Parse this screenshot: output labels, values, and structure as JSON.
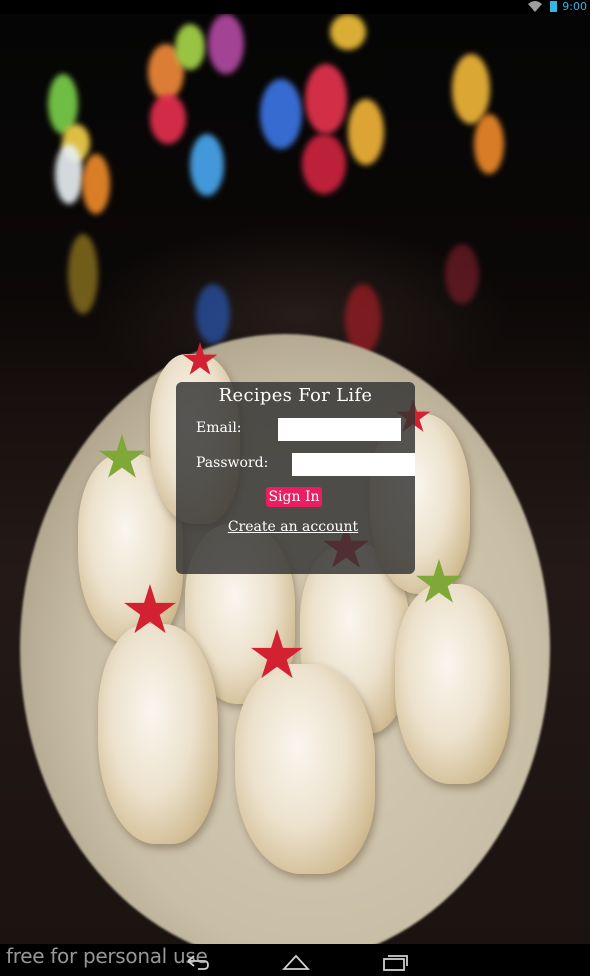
{
  "status_bar": {
    "time": "9:00",
    "icons": [
      "wifi-icon",
      "battery-icon"
    ],
    "accent_color": "#33b5e5"
  },
  "background": {
    "description_icon": "cookies-plate-photo"
  },
  "login": {
    "title": "Recipes For Life",
    "email_label": "Email:",
    "email_value": "",
    "password_label": "Password:",
    "password_value": "",
    "sign_in_label": "Sign In",
    "create_account_label": "Create an account",
    "button_color": "#e91e63"
  },
  "watermark": "free for personal use",
  "nav_bar": {
    "icons": [
      "back-icon",
      "home-icon",
      "recents-icon"
    ]
  }
}
